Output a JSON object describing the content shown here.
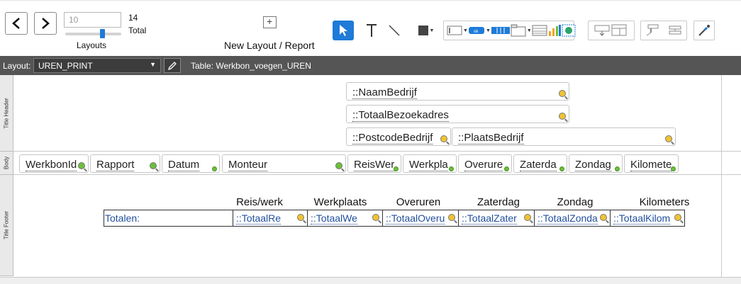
{
  "toolbar": {
    "record_value": "10",
    "total_count": "14",
    "total_label": "Total",
    "layouts_label": "Layouts",
    "new_layout_label": "New Layout / Report"
  },
  "layout_bar": {
    "layout_label": "Layout:",
    "layout_value": "UREN_PRINT",
    "table_label": "Table: Werkbon_voegen_UREN"
  },
  "parts": {
    "header": "Title Header",
    "body": "Body",
    "footer": "Title Footer"
  },
  "header_fields": [
    "::NaamBedrijf",
    "::TotaalBezoekadres",
    "::PostcodeBedrijf",
    "::PlaatsBedrijf"
  ],
  "body_fields": [
    "WerkbonId",
    "Rapport",
    "Datum",
    "Monteur",
    "ReisWer",
    "Werkpla",
    "Overure",
    "Zaterda",
    "Zondag",
    "Kilomete"
  ],
  "footer": {
    "column_headers": [
      "Reis/werk",
      "Werkplaats",
      "Overuren",
      "Zaterdag",
      "Zondag",
      "Kilometers"
    ],
    "totals_label": "Totalen:",
    "total_fields": [
      "::TotaalRe",
      "::TotaalWe",
      "::TotaalOveru",
      "::TotaalZater",
      "::TotaalZonda",
      "::TotaalKilom"
    ]
  },
  "colors": {
    "accent": "#1e7bd8",
    "layout_bar": "#555555",
    "field_text_blue": "#1f4e9c"
  }
}
